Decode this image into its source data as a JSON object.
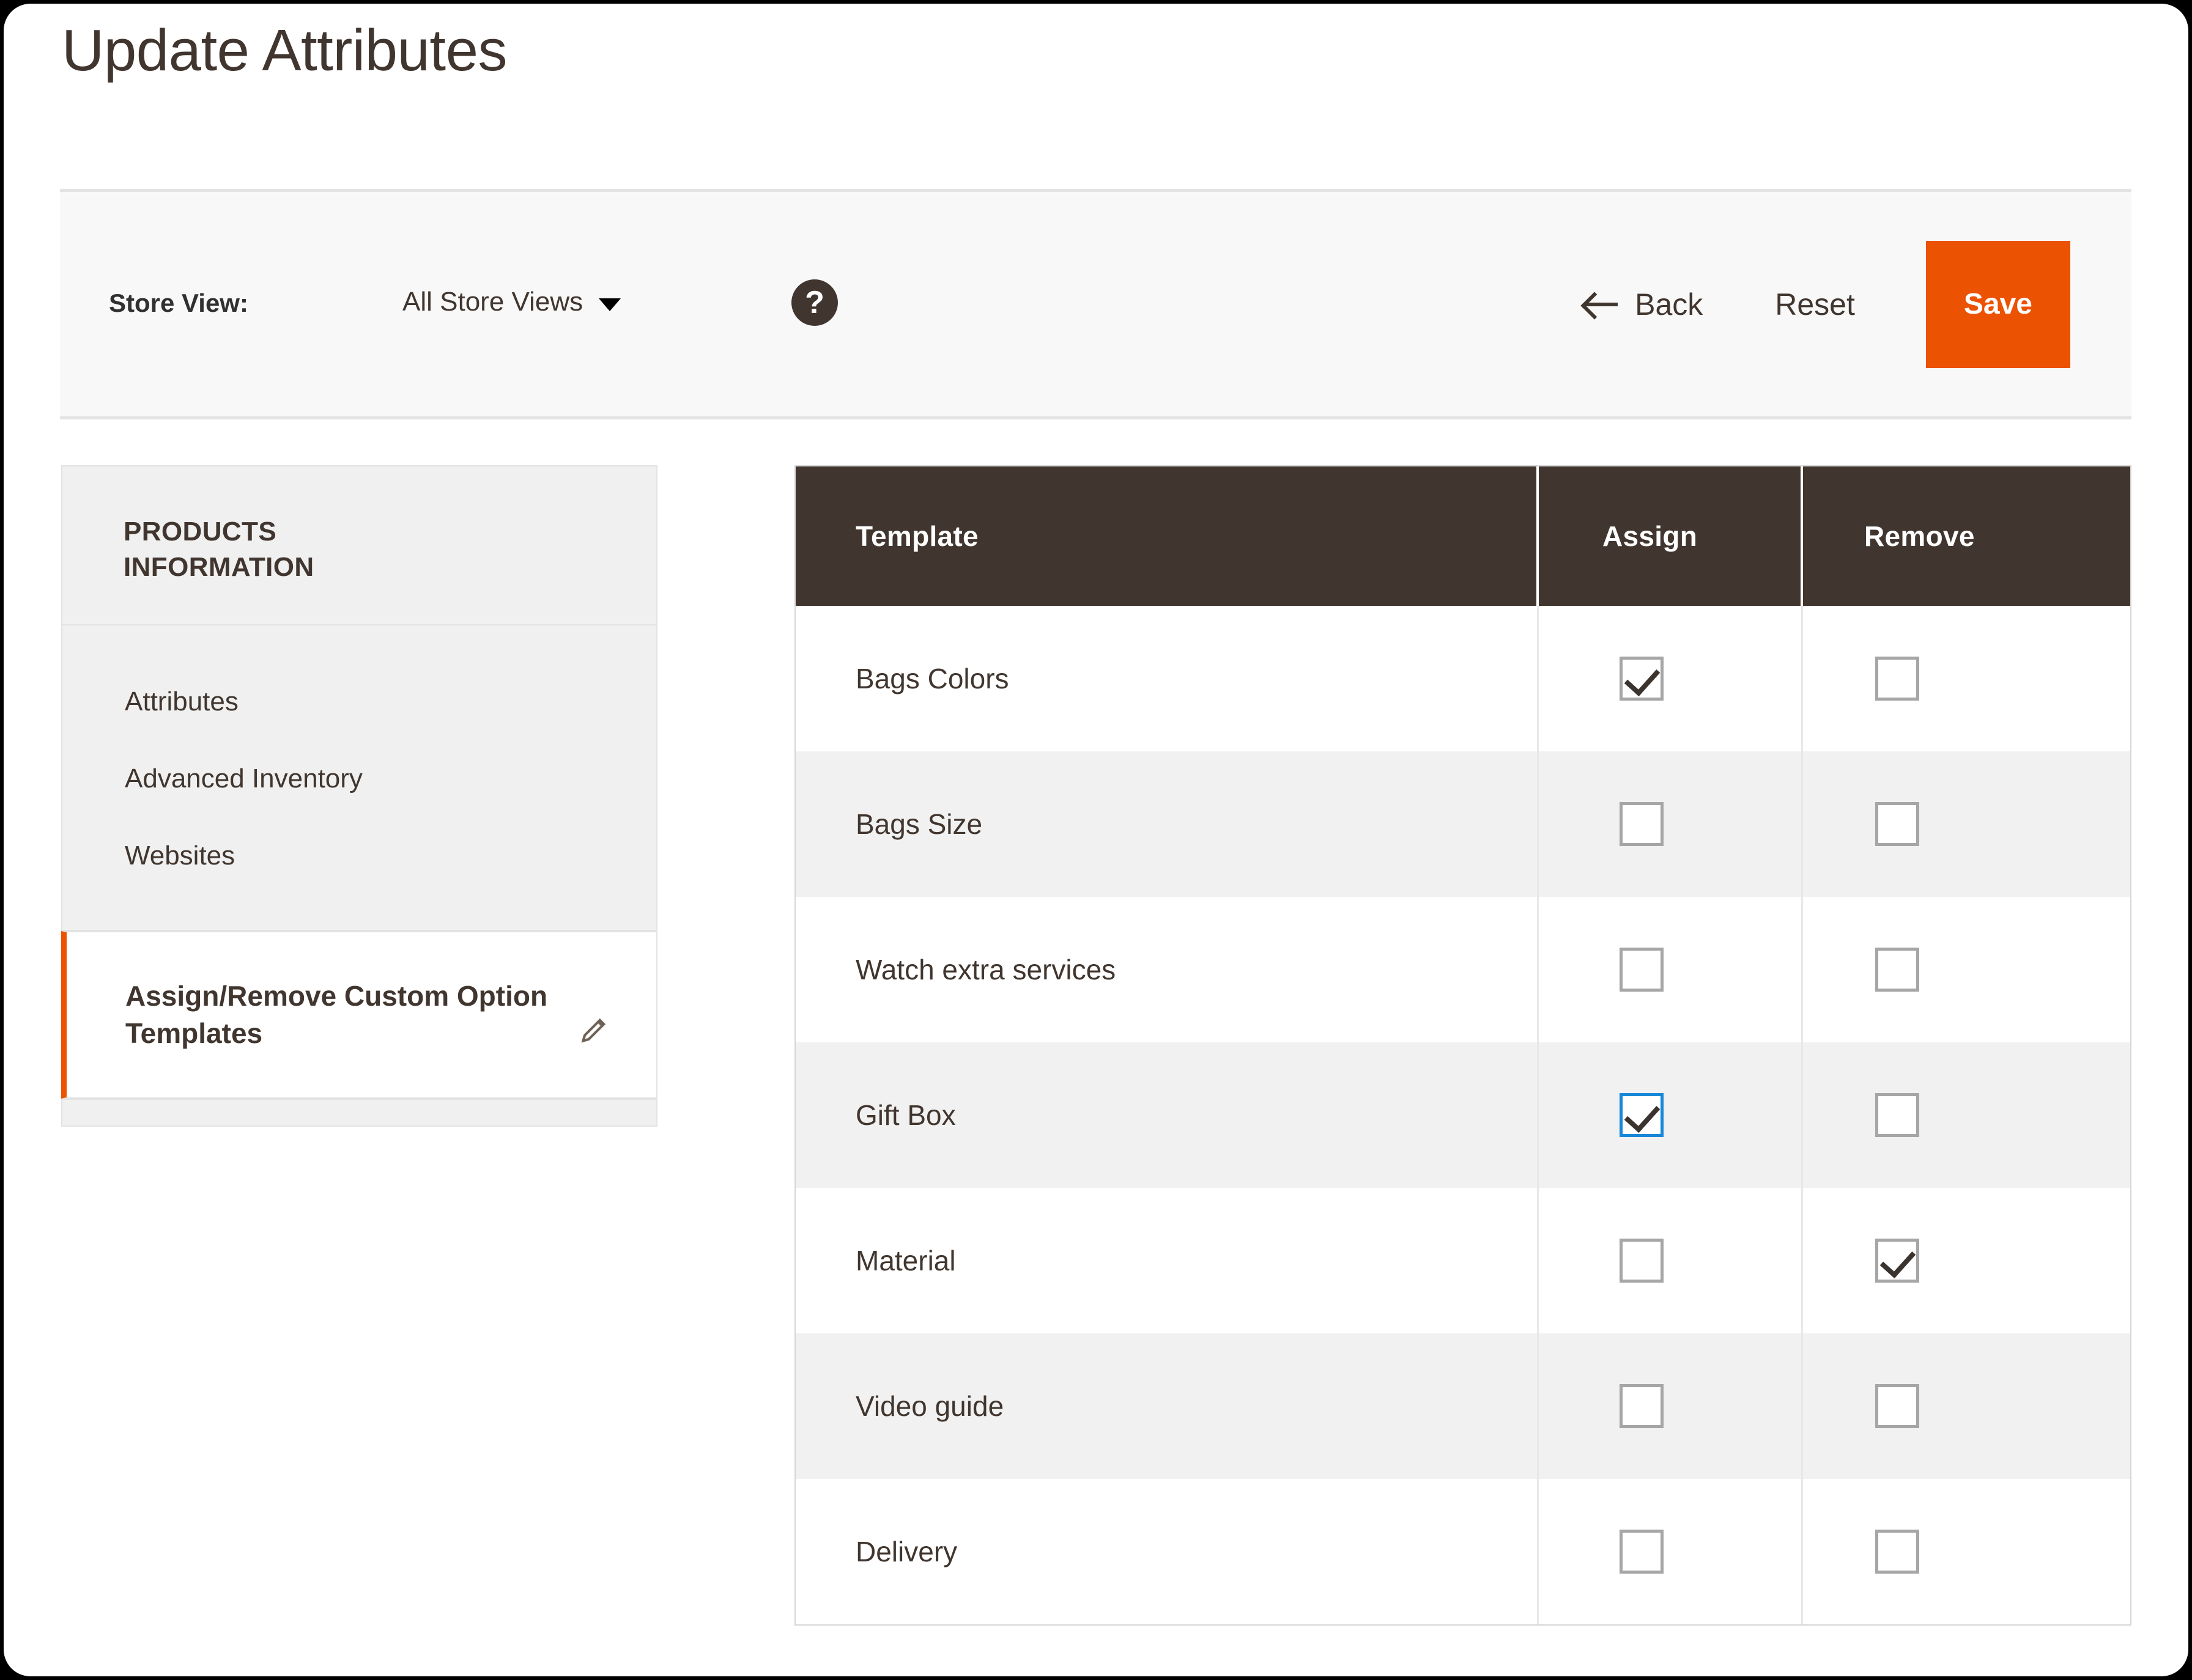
{
  "page": {
    "title": "Update Attributes"
  },
  "toolbar": {
    "store_view_label": "Store View:",
    "store_view_value": "All Store Views",
    "help_icon": "help-circle-icon",
    "caret_icon": "chevron-down-icon",
    "back_label": "Back",
    "back_icon": "arrow-left-icon",
    "reset_label": "Reset",
    "save_label": "Save",
    "save_color": "#eb5202"
  },
  "sidebar": {
    "header_title": "PRODUCTS INFORMATION",
    "items": [
      {
        "label": "Attributes"
      },
      {
        "label": "Advanced Inventory"
      },
      {
        "label": "Websites"
      }
    ],
    "active_item": {
      "label": "Assign/Remove Custom Option Templates",
      "icon": "pencil-icon",
      "accent_color": "#eb5202"
    }
  },
  "table": {
    "header_bg": "#41362f",
    "columns": [
      "Template",
      "Assign",
      "Remove"
    ],
    "rows": [
      {
        "template": "Bags Colors",
        "assign": true,
        "assign_focused": false,
        "remove": false
      },
      {
        "template": "Bags Size",
        "assign": false,
        "assign_focused": false,
        "remove": false
      },
      {
        "template": "Watch extra services",
        "assign": false,
        "assign_focused": false,
        "remove": false
      },
      {
        "template": "Gift Box",
        "assign": true,
        "assign_focused": true,
        "remove": false
      },
      {
        "template": "Material",
        "assign": false,
        "assign_focused": false,
        "remove": true
      },
      {
        "template": "Video guide",
        "assign": false,
        "assign_focused": false,
        "remove": false
      },
      {
        "template": "Delivery",
        "assign": false,
        "assign_focused": false,
        "remove": false
      }
    ]
  }
}
